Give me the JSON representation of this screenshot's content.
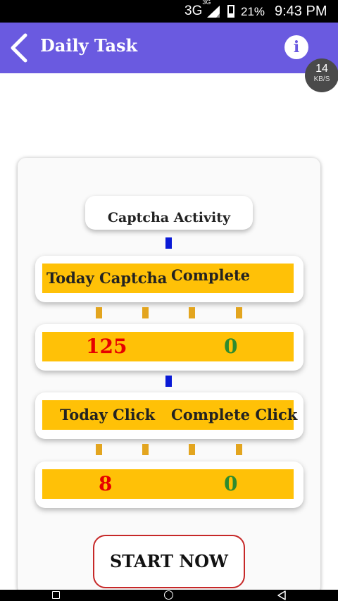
{
  "status_bar": {
    "network": "3G",
    "network_sup": "3G",
    "battery": "21%",
    "time": "9:43 PM"
  },
  "app_bar": {
    "title": "Daily Task",
    "back_icon": "back-arrow-icon",
    "info_icon": "info-icon",
    "info_glyph": "i",
    "color": "#6a5ae0"
  },
  "speed_indicator": {
    "value": "14",
    "unit": "KB/S"
  },
  "activity": {
    "title": "Captcha Activity"
  },
  "captcha": {
    "header_left": "Today Captcha",
    "header_right": "Complete",
    "today_value": "125",
    "complete_value": "0"
  },
  "clicks": {
    "header_left": "Today Click",
    "header_right": "Complete Click",
    "today_value": "8",
    "complete_value": "0"
  },
  "start_button": {
    "label": "START NOW"
  },
  "colors": {
    "accent": "#6a5ae0",
    "highlight": "#ffc107",
    "today_value": "#e60000",
    "complete_value": "#2e8b2e",
    "button_border": "#c62828"
  },
  "nav_bar": {
    "recent_icon": "recent-apps-icon",
    "home_icon": "home-icon",
    "back_icon": "nav-back-icon"
  }
}
